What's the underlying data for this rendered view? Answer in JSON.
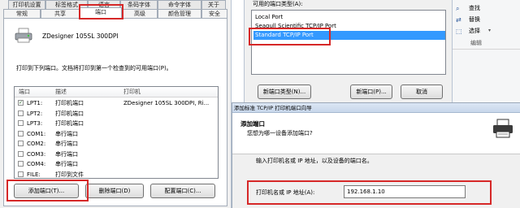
{
  "left_dialog": {
    "tabs_row1": [
      "打印机设置",
      "标签格式",
      "语言",
      "条码字体",
      "命令字体",
      "关于"
    ],
    "tabs_row2": [
      "常规",
      "共享",
      "端口",
      "高级",
      "颜色管理",
      "安全"
    ],
    "printer_name": "ZDesigner 105SL 300DPI",
    "instruction": "打印到下列端口。文档将打印到第一个检查到的可用端口(P)。",
    "columns": [
      "端口",
      "描述",
      "打印机"
    ],
    "ports": [
      {
        "port": "LPT1:",
        "desc": "打印机端口",
        "printer": "ZDesigner 105SL 300DPI, Ri...",
        "checked": true
      },
      {
        "port": "LPT2:",
        "desc": "打印机端口",
        "printer": "",
        "checked": false
      },
      {
        "port": "LPT3:",
        "desc": "打印机端口",
        "printer": "",
        "checked": false
      },
      {
        "port": "COM1:",
        "desc": "串行端口",
        "printer": "",
        "checked": false
      },
      {
        "port": "COM2:",
        "desc": "串行端口",
        "printer": "",
        "checked": false
      },
      {
        "port": "COM3:",
        "desc": "串行端口",
        "printer": "",
        "checked": false
      },
      {
        "port": "COM4:",
        "desc": "串行端口",
        "printer": "",
        "checked": false
      },
      {
        "port": "FILE:",
        "desc": "打印到文件",
        "printer": "",
        "checked": false
      }
    ],
    "buttons": {
      "add": "添加端口(T)...",
      "delete": "删除端口(D)",
      "configure": "配置端口(C)..."
    }
  },
  "mid_dialog": {
    "label": "可用的端口类型(A):",
    "port_types": [
      "Local Port",
      "Seagull Scientific TCP/IP Port",
      "Standard TCP/IP Port"
    ],
    "selected_index": 2,
    "buttons": {
      "new_type": "新端口类型(N)...",
      "new_port": "新端口(P)...",
      "cancel": "取消"
    }
  },
  "ribbon": {
    "find": "查找",
    "replace": "替换",
    "select": "选择",
    "group": "编辑"
  },
  "wizard": {
    "title": "添加标准 TCP/IP 打印机端口向导",
    "heading": "添加端口",
    "subheading": "您想为哪一设备添加端口?",
    "prompt": "输入打印机名或 IP 地址，以及设备的端口名。",
    "field_label": "打印机名或 IP 地址(A):",
    "field_value": "192.168.1.10"
  },
  "colors": {
    "highlight": "#d62828",
    "selection": "#3399ff"
  }
}
